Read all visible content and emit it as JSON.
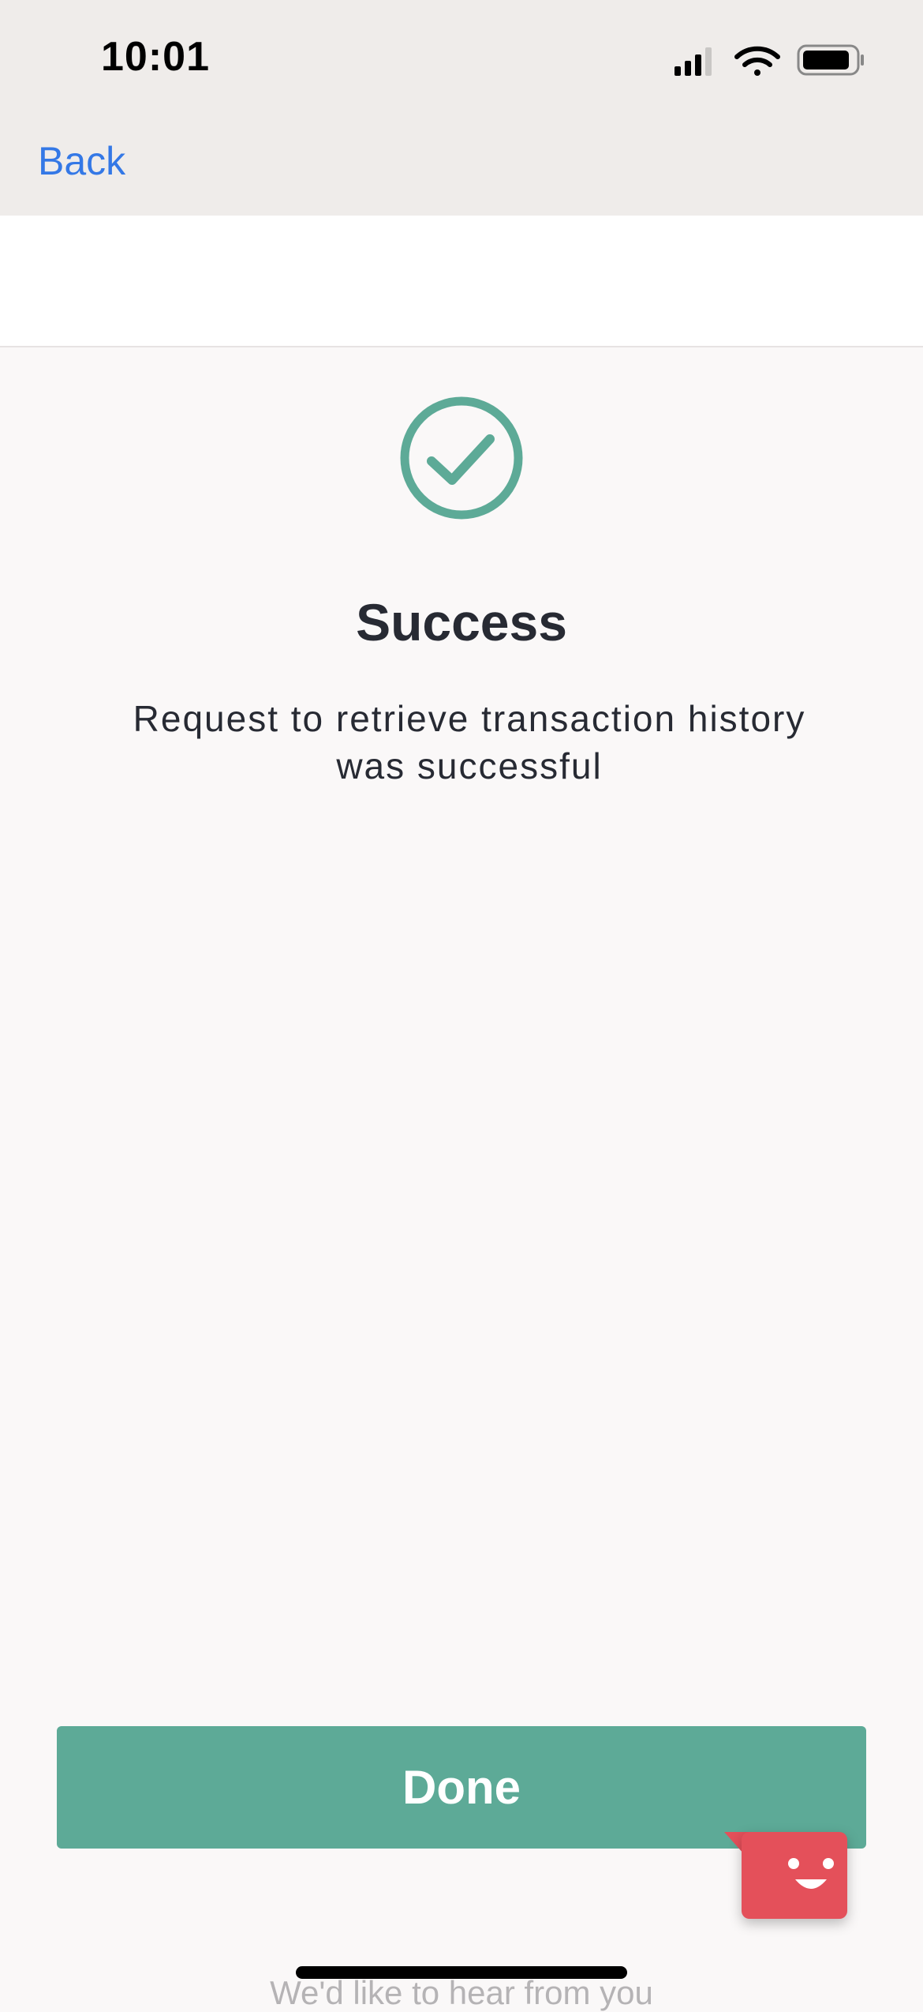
{
  "status_bar": {
    "time": "10:01",
    "icons": [
      "signal-icon",
      "wifi-icon",
      "battery-icon"
    ]
  },
  "nav": {
    "back_label": "Back"
  },
  "content": {
    "icon": "check-circle-icon",
    "title": "Success",
    "message": "Request to retrieve transaction history was successful"
  },
  "actions": {
    "done_label": "Done"
  },
  "feedback": {
    "icon": "smiley-feedback-icon",
    "text": "We'd like to hear from you"
  },
  "colors": {
    "accent": "#5daa97",
    "link": "#3478e6",
    "feedback": "#e4505a",
    "header_bg": "#efecea",
    "text": "#272a33"
  }
}
